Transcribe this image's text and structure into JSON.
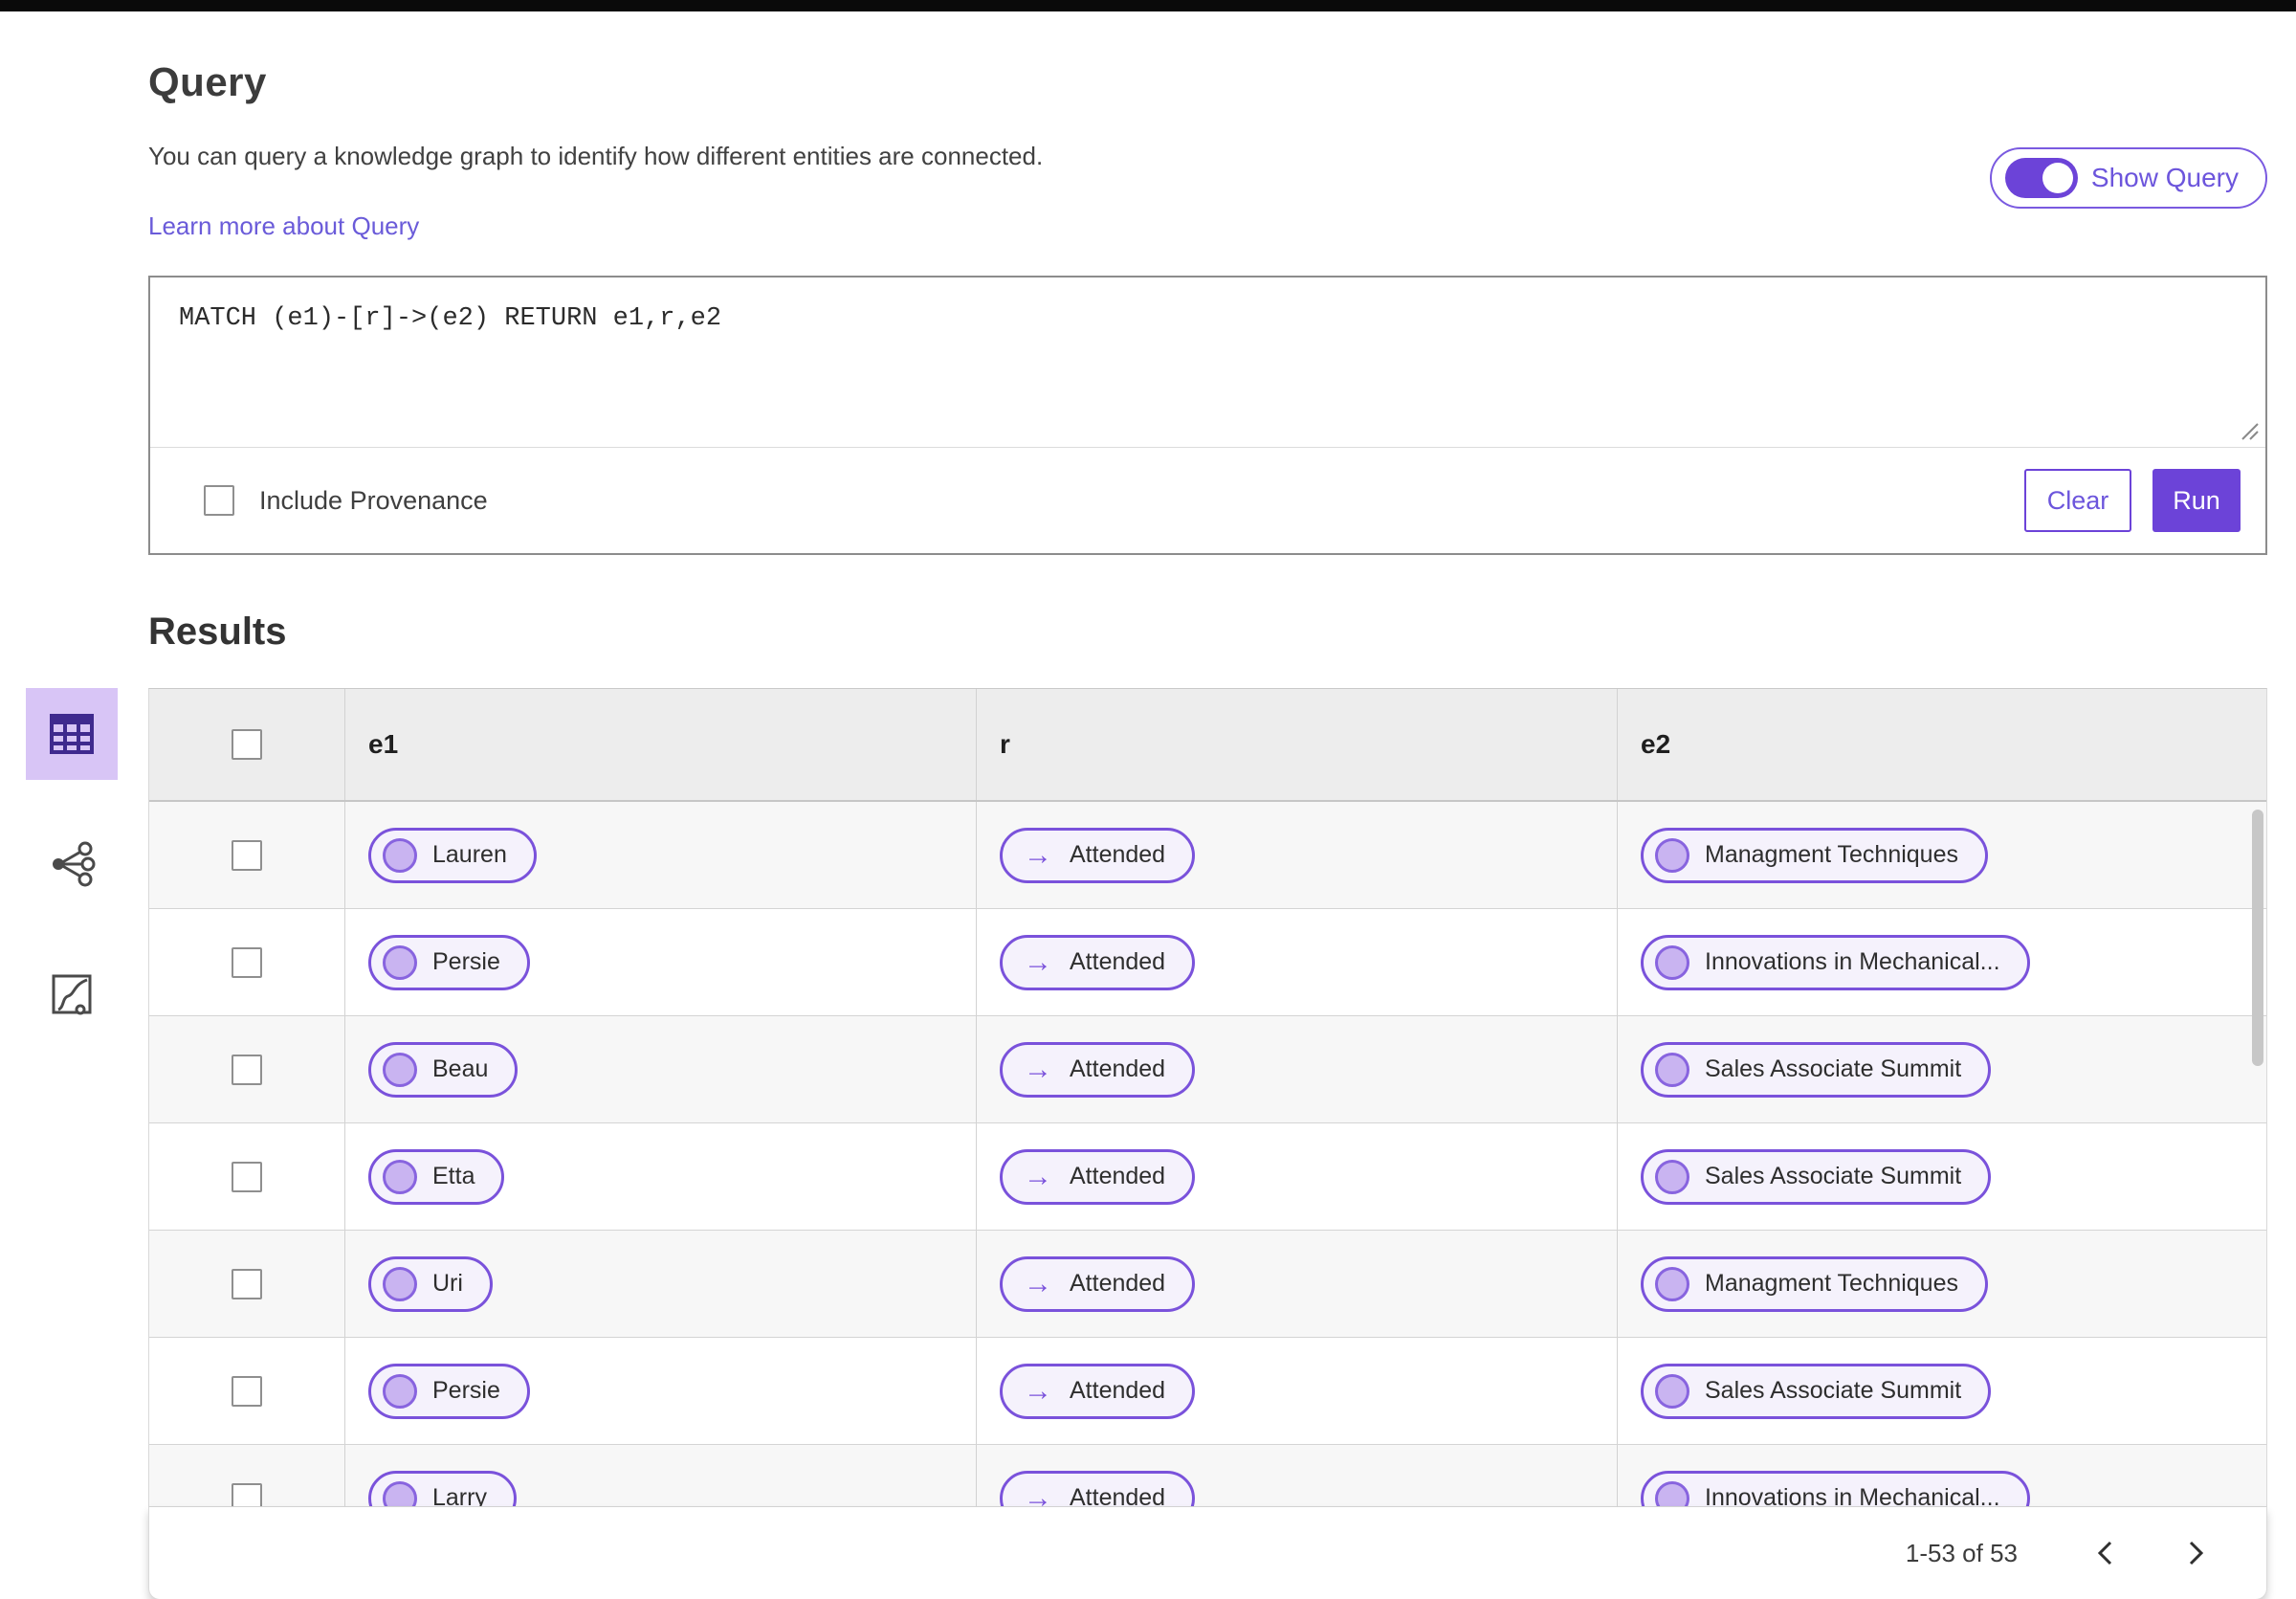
{
  "colors": {
    "accent_purple": "#6C43D8",
    "pill_border": "#7A52DB",
    "pill_background": "#F5F2FC",
    "pill_dot_fill": "#C9B4F1",
    "link_purple": "#6A5BD9",
    "selected_view_background": "#D8C5F6",
    "table_header_background": "#EDEDED",
    "row_alternate_background": "#F7F7F7",
    "top_bar": "#0a0a0a"
  },
  "icons": {
    "relation_arrow": "→"
  },
  "query_section": {
    "title": "Query",
    "description": "You can query a knowledge graph to identify how different entities are connected.",
    "learn_more_link": "Learn more about Query",
    "show_query_toggle": {
      "label": "Show Query",
      "state": "on"
    },
    "query_input": {
      "value": "MATCH (e1)-[r]->(e2) RETURN e1,r,e2"
    },
    "include_provenance": {
      "label": "Include Provenance",
      "checked": false
    },
    "buttons": {
      "clear": "Clear",
      "run": "Run"
    }
  },
  "results_section": {
    "title": "Results",
    "view_switcher": [
      {
        "name": "table-view",
        "selected": true
      },
      {
        "name": "graph-view",
        "selected": false
      },
      {
        "name": "chart-view",
        "selected": false
      }
    ],
    "table": {
      "columns": [
        "e1",
        "r",
        "e2"
      ],
      "rows": [
        {
          "e1": "Lauren",
          "r": "Attended",
          "e2": "Managment Techniques"
        },
        {
          "e1": "Persie",
          "r": "Attended",
          "e2": "Innovations in Mechanical..."
        },
        {
          "e1": "Beau",
          "r": "Attended",
          "e2": "Sales Associate Summit"
        },
        {
          "e1": "Etta",
          "r": "Attended",
          "e2": "Sales Associate Summit"
        },
        {
          "e1": "Uri",
          "r": "Attended",
          "e2": "Managment Techniques"
        },
        {
          "e1": "Persie",
          "r": "Attended",
          "e2": "Sales Associate Summit"
        },
        {
          "e1": "Larry",
          "r": "Attended",
          "e2": "Innovations in Mechanical..."
        }
      ]
    },
    "pagination": {
      "range_label": "1-53 of 53"
    }
  }
}
